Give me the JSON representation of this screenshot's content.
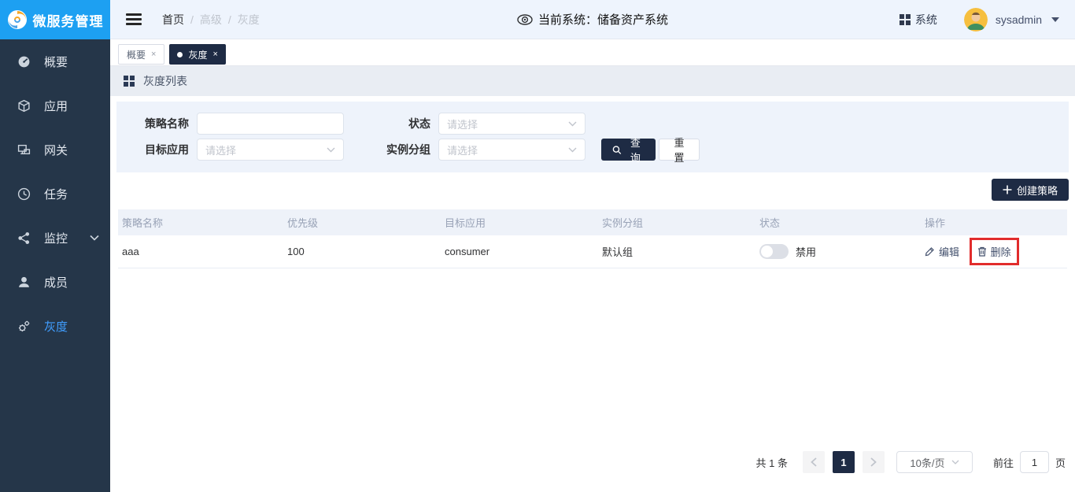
{
  "topbar": {
    "logo_text": "微服务管理",
    "breadcrumb": {
      "home": "首页",
      "sep": "/",
      "mid": "高级",
      "last": "灰度"
    },
    "current_system": "当前系统：储备资产系统",
    "system_label": "系统",
    "username": "sysadmin"
  },
  "sidebar": {
    "items": [
      {
        "label": "概要",
        "icon": "dashboard-icon"
      },
      {
        "label": "应用",
        "icon": "app-icon"
      },
      {
        "label": "网关",
        "icon": "gateway-icon"
      },
      {
        "label": "任务",
        "icon": "task-icon"
      },
      {
        "label": "监控",
        "icon": "monitor-icon"
      },
      {
        "label": "成员",
        "icon": "member-icon"
      },
      {
        "label": "灰度",
        "icon": "grayscale-icon"
      }
    ]
  },
  "tabs": {
    "overview": "概要",
    "gray": "灰度",
    "close": "×"
  },
  "section": {
    "title": "灰度列表"
  },
  "filter": {
    "policy_name_label": "策略名称",
    "status_label": "状态",
    "target_app_label": "目标应用",
    "instance_group_label": "实例分组",
    "select_placeholder": "请选择",
    "search_label": "查询",
    "reset_label": "重置"
  },
  "create_button_label": "创建策略",
  "table": {
    "headers": [
      "策略名称",
      "优先级",
      "目标应用",
      "实例分组",
      "状态",
      "操作"
    ],
    "rows": [
      {
        "name": "aaa",
        "priority": "100",
        "target_app": "consumer",
        "instance_group": "默认组",
        "status_text": "禁用",
        "edit_label": "编辑",
        "delete_label": "删除"
      }
    ]
  },
  "pagination": {
    "total": "共 1 条",
    "current_page": "1",
    "page_size": "10条/页",
    "goto_label": "前往",
    "goto_value": "1",
    "page_unit": "页"
  },
  "colors": {
    "logo_blue": "#1da0f2",
    "sidebar_bg": "#253649",
    "primary_dark": "#1e2b44",
    "active_link_blue": "#409eff",
    "topbar_bg": "#eef4fd",
    "filter_panel_bg": "#eef3fb",
    "table_header_bg": "#eef2f9",
    "highlight_red": "#e12c2c",
    "avatar_bg": "#f6bf3f"
  }
}
